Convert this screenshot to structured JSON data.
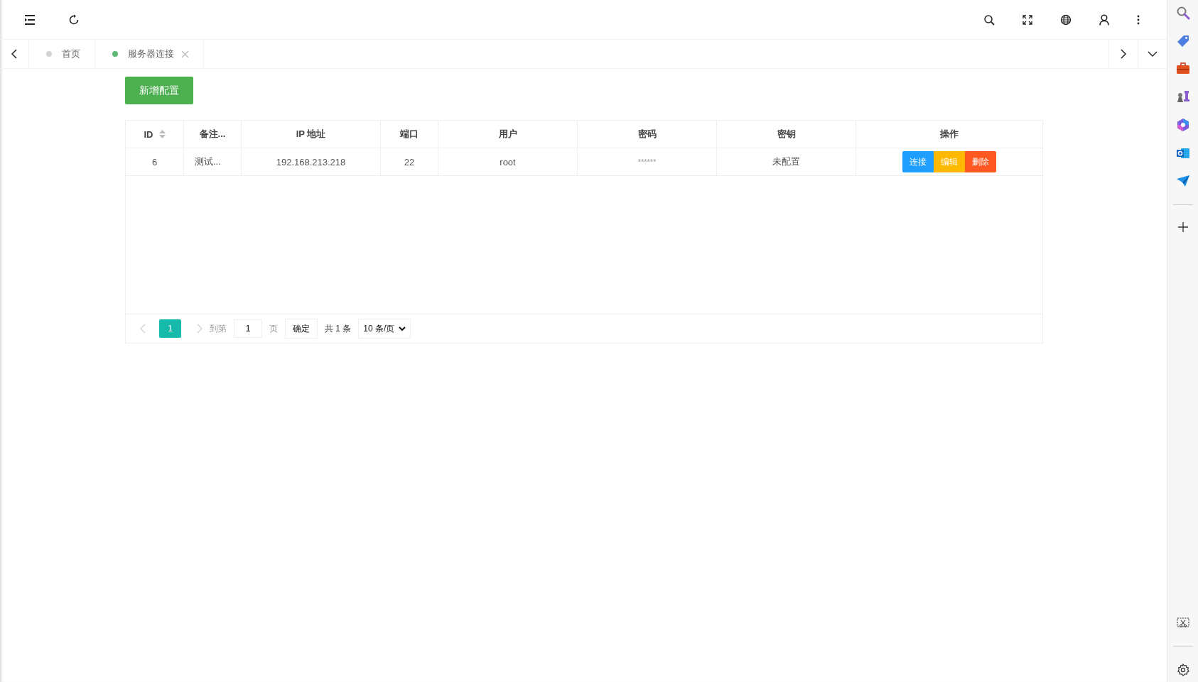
{
  "tabs": [
    {
      "label": "首页",
      "selected": false,
      "closable": false
    },
    {
      "label": "服务器连接",
      "selected": true,
      "closable": true
    }
  ],
  "add_button": "新增配置",
  "table": {
    "columns": [
      {
        "label": "ID",
        "sortable": true
      },
      {
        "label": "备注...",
        "sortable": false
      },
      {
        "label": "IP 地址",
        "sortable": false
      },
      {
        "label": "端口",
        "sortable": false
      },
      {
        "label": "用户",
        "sortable": false
      },
      {
        "label": "密码",
        "sortable": false
      },
      {
        "label": "密钥",
        "sortable": false
      },
      {
        "label": "操作",
        "sortable": false
      }
    ],
    "rows": [
      {
        "cells": [
          "6",
          "测试...",
          "192.168.213.218",
          "22",
          "root",
          "******",
          "未配置"
        ],
        "actions": [
          {
            "label": "连接",
            "kind": "connect"
          },
          {
            "label": "编辑",
            "kind": "edit"
          },
          {
            "label": "删除",
            "kind": "delete"
          }
        ]
      }
    ]
  },
  "pagination": {
    "prev_disabled": true,
    "pages": [
      {
        "label": "1",
        "selected": true
      }
    ],
    "next_disabled": true,
    "goto_label": "到第",
    "goto_value": "1",
    "page_unit": "页",
    "confirm": "确定",
    "total": "共 1 条",
    "page_size": "10 条/页"
  }
}
